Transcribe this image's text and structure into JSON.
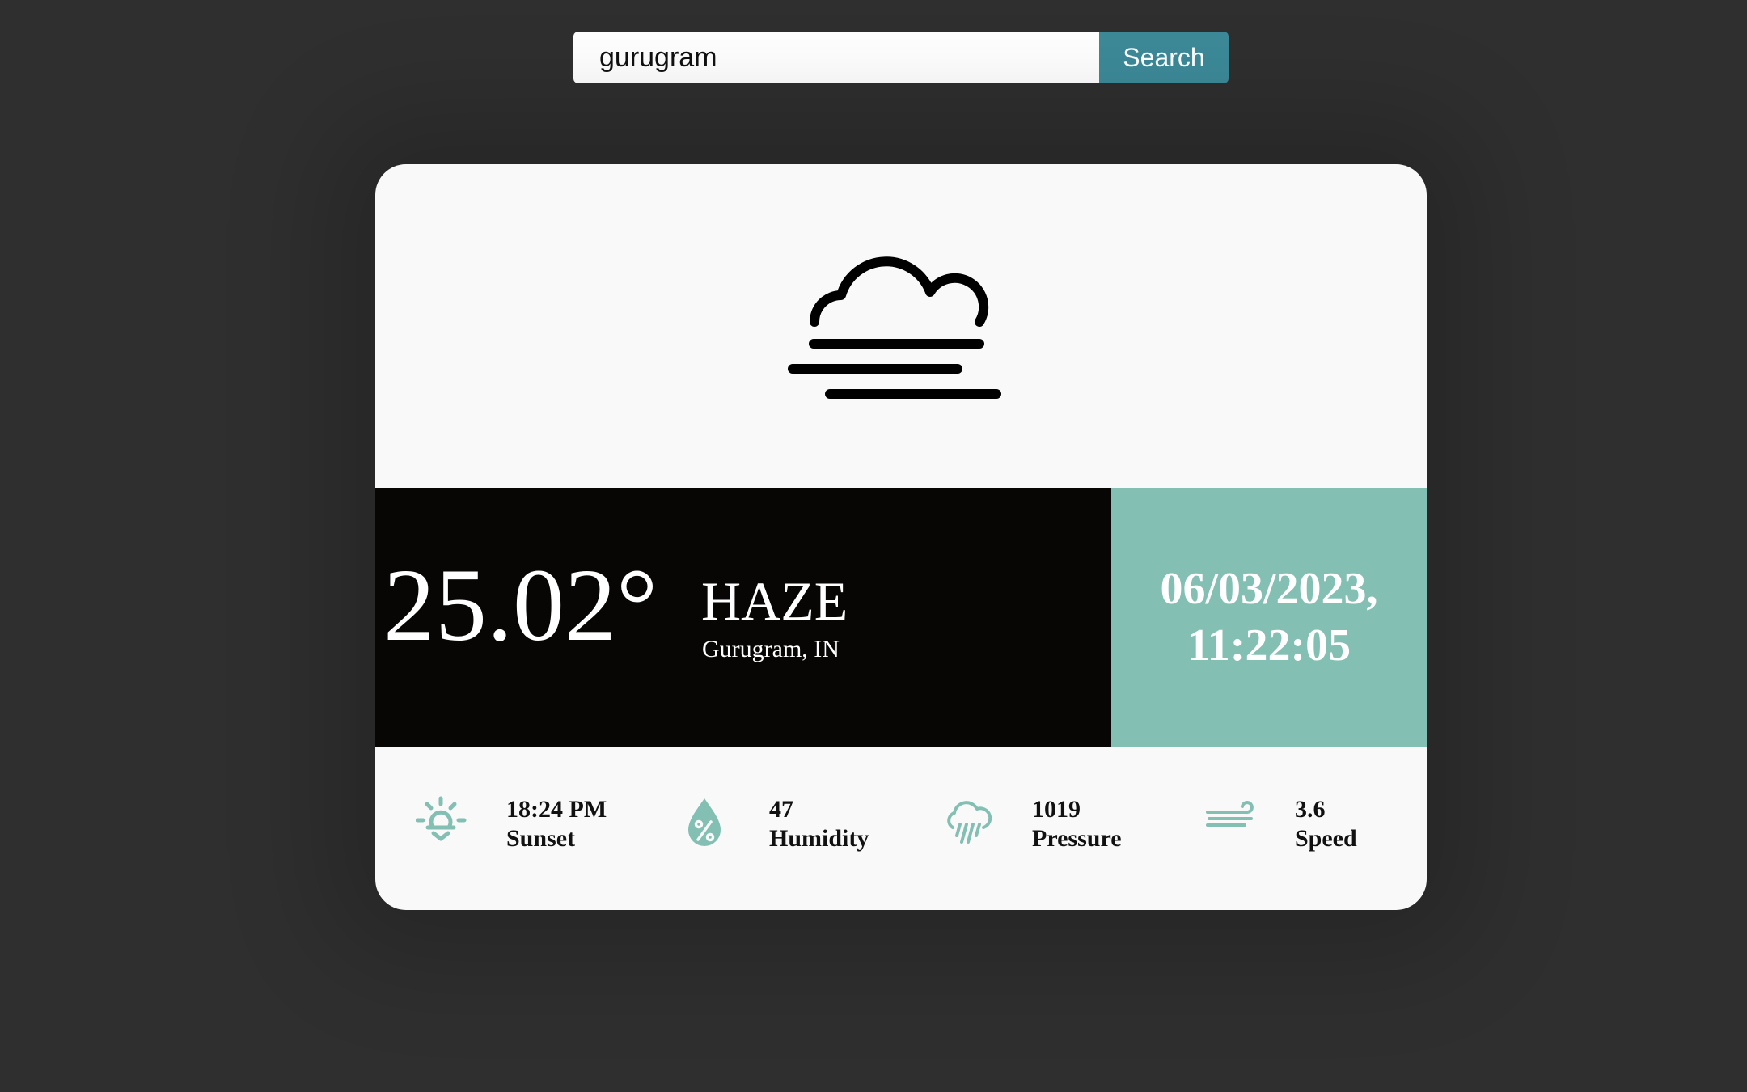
{
  "search": {
    "value": "gurugram",
    "placeholder": "",
    "button_label": "Search"
  },
  "weather": {
    "icon": "haze-icon",
    "temperature": "25.02°",
    "condition": "HAZE",
    "location": "Gurugram, IN",
    "date": "06/03/2023,",
    "time": "11:22:05"
  },
  "stats": [
    {
      "icon": "sunset-icon",
      "value": "18:24 PM",
      "label": "Sunset"
    },
    {
      "icon": "humidity-icon",
      "value": "47",
      "label": "Humidity"
    },
    {
      "icon": "pressure-icon",
      "value": "1019",
      "label": "Pressure"
    },
    {
      "icon": "wind-icon",
      "value": "3.6",
      "label": "Speed"
    }
  ],
  "colors": {
    "background": "#2f2f2f",
    "card": "#f9f9f9",
    "band_dark": "#070605",
    "band_accent": "#84bfb4",
    "search_button": "#3d8a99",
    "icon_accent": "#84bfb4"
  }
}
